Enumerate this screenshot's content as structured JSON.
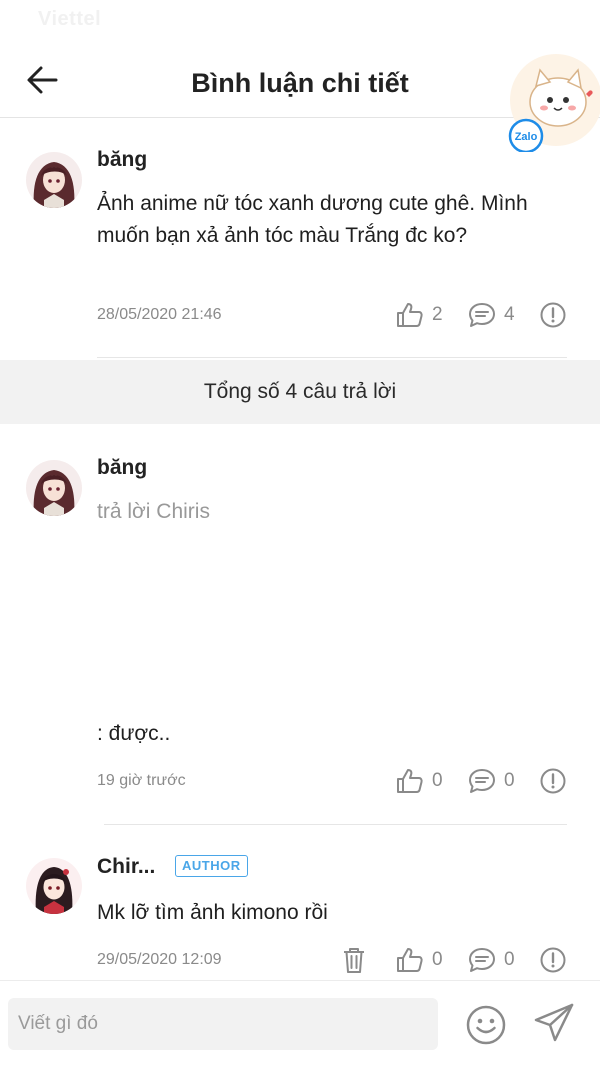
{
  "status_bar": {
    "carrier": "Viettel"
  },
  "header": {
    "title": "Bình luận chi tiết"
  },
  "zalo_widget": {
    "label": "Zalo"
  },
  "main_comment": {
    "username": "băng",
    "text": "Ảnh anime nữ tóc xanh dương cute ghê. Mình muốn bạn xả ảnh tóc màu Trắng đc ko?",
    "timestamp": "28/05/2020 21:46",
    "likes": "2",
    "replies": "4"
  },
  "replies_banner": {
    "text": "Tổng số 4 câu trả lời"
  },
  "replies": [
    {
      "username": "băng",
      "reply_to": "trả lời Chiris",
      "text": ": được..",
      "timestamp": "19 giờ trước",
      "likes": "0",
      "replies": "0"
    },
    {
      "username": "Chir...",
      "badge": "AUTHOR",
      "text": "Mk lỡ tìm ảnh kimono rồi",
      "timestamp": "29/05/2020 12:09",
      "likes": "0",
      "replies": "0"
    }
  ],
  "input_bar": {
    "placeholder": "Viết gì đó"
  },
  "colors": {
    "accent_blue": "#4aa6e8",
    "icon_gray": "#8a8a8a",
    "banner_bg": "#f2f2f2"
  }
}
